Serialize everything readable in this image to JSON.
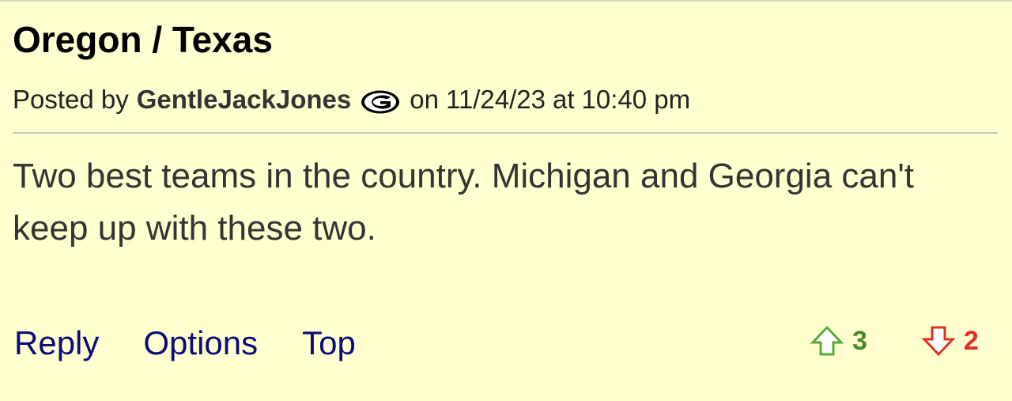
{
  "post": {
    "title": "Oregon / Texas",
    "posted_by_label": "Posted by",
    "author": "GentleJackJones",
    "author_badge_icon": "georgia-g-logo-icon",
    "on_label": "on",
    "date": "11/24/23",
    "at_label": "at",
    "time": "10:40 pm",
    "body": "Two best teams in the country. Michigan and Georgia can't keep up with these two."
  },
  "actions": {
    "reply": "Reply",
    "options": "Options",
    "top": "Top"
  },
  "votes": {
    "up_icon": "thumbs-up-arrow-icon",
    "up_count": "3",
    "up_color": "#4a8a2a",
    "down_icon": "thumbs-down-arrow-icon",
    "down_count": "2",
    "down_color": "#e03020"
  },
  "colors": {
    "background": "#ffffd0",
    "link": "#0a0a7a"
  }
}
